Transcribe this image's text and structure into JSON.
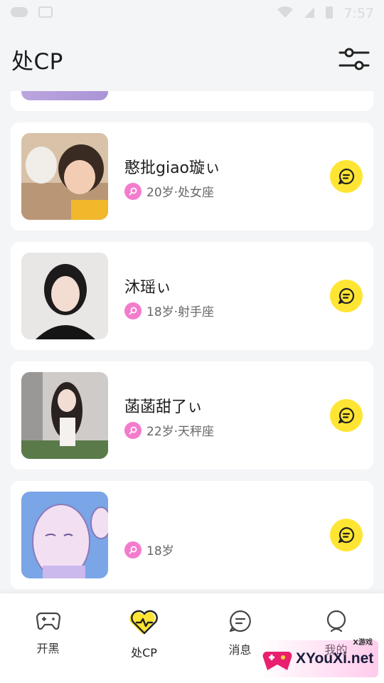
{
  "status_bar": {
    "time": "7:57"
  },
  "header": {
    "title": "处CP"
  },
  "cards": [
    {
      "name": "憨批giao璇ぃ",
      "meta": "20岁·处女座"
    },
    {
      "name": "沐瑶ぃ",
      "meta": "18岁·射手座"
    },
    {
      "name": "菡菡甜了ぃ",
      "meta": "22岁·天秤座"
    },
    {
      "name": "",
      "meta": "18岁"
    }
  ],
  "tabbar": [
    {
      "label": "开黑",
      "icon": "gamepad-icon"
    },
    {
      "label": "处CP",
      "icon": "heartbeat-icon"
    },
    {
      "label": "消息",
      "icon": "message-icon"
    },
    {
      "label": "我的",
      "icon": "profile-icon"
    }
  ],
  "watermark": {
    "text": "XYouXi.net",
    "top": "X游戏"
  },
  "colors": {
    "accent": "#ffe533",
    "gender_female": "#f37ccd",
    "background": "#f4f5f7"
  }
}
